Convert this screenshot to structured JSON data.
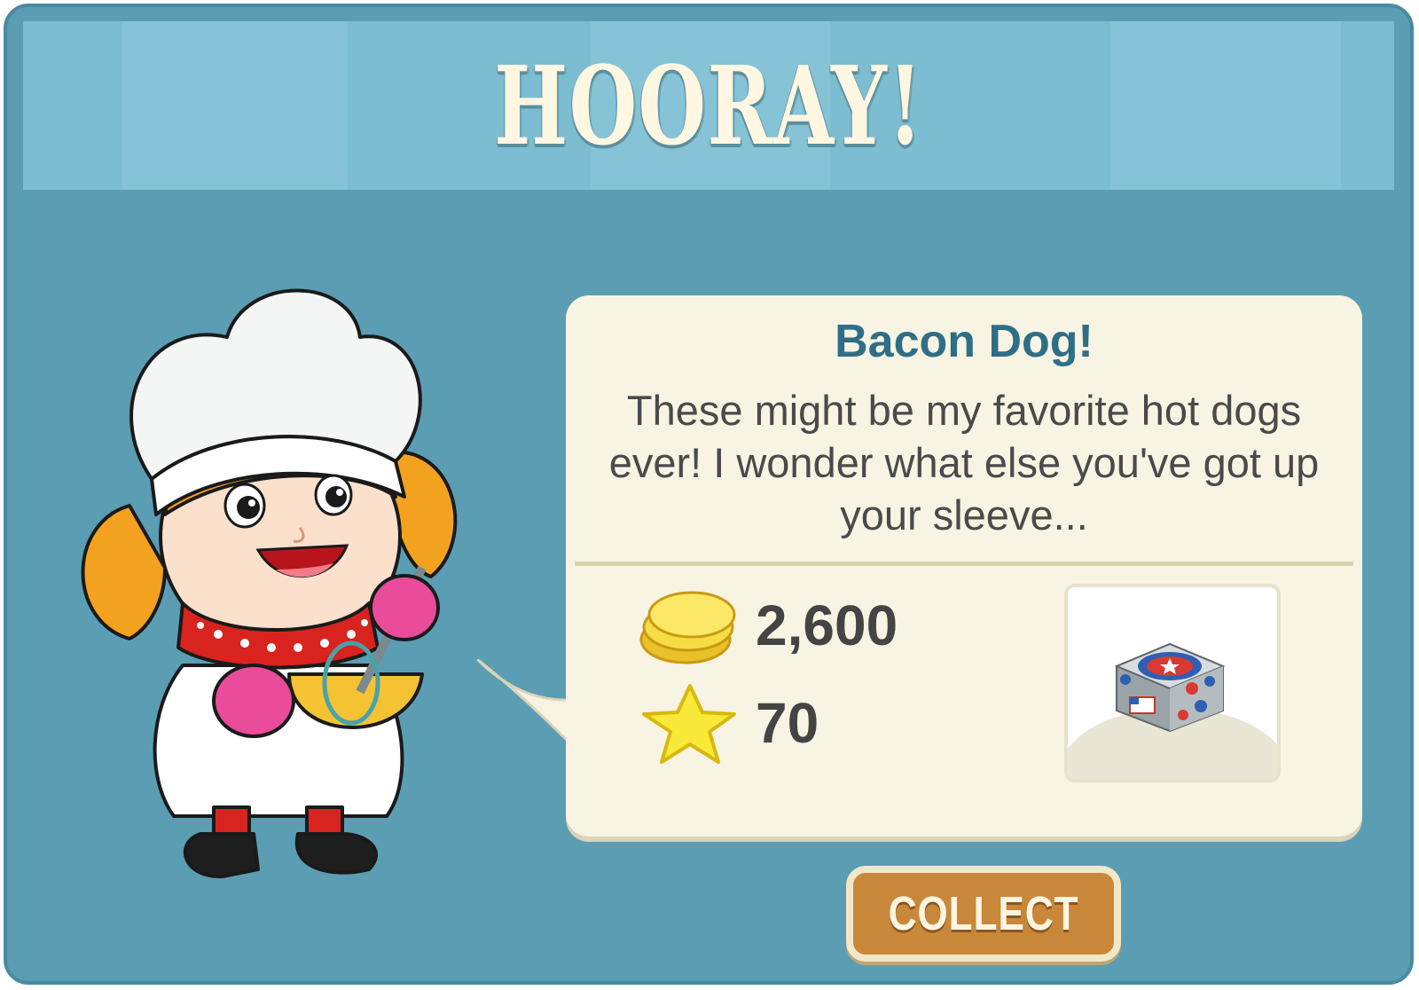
{
  "header": {
    "title": "HOORAY!"
  },
  "card": {
    "title": "Bacon Dog!",
    "body": "These might be my favorite hot dogs ever! I wonder what else you've got up your sleeve..."
  },
  "rewards": {
    "coins": {
      "icon": "coins-icon",
      "value": "2,600"
    },
    "xp": {
      "icon": "star-icon",
      "value": "70"
    },
    "item": {
      "icon": "patriotic-appliance-icon"
    }
  },
  "buttons": {
    "collect_label": "COLLECT"
  },
  "colors": {
    "background": "#5b9db3",
    "header": "#7dbdd1",
    "card": "#f8f4e4",
    "title": "#2f6e87",
    "button": "#c9873a"
  }
}
